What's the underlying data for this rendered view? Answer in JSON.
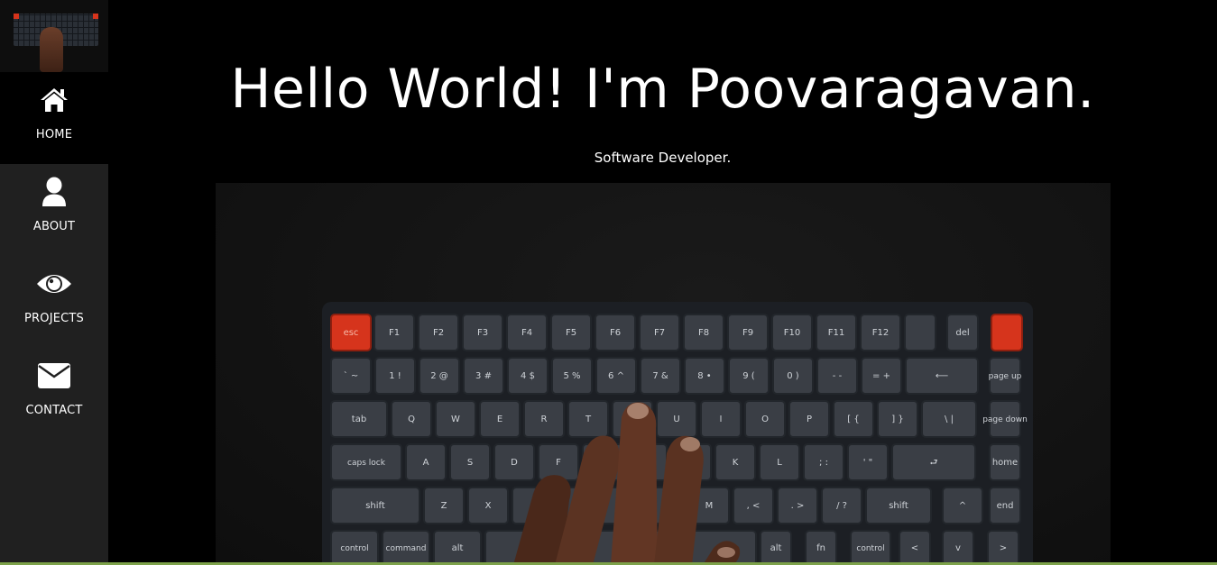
{
  "sidebar": {
    "items": [
      {
        "label": "HOME",
        "icon": "home-icon",
        "active": true
      },
      {
        "label": "ABOUT",
        "icon": "user-icon",
        "active": false
      },
      {
        "label": "PROJECTS",
        "icon": "eye-icon",
        "active": false
      },
      {
        "label": "CONTACT",
        "icon": "envelope-icon",
        "active": false
      }
    ]
  },
  "hero": {
    "title": "Hello World! I'm Poovaragavan.",
    "subtitle": "Software Developer."
  },
  "keyboard": {
    "rows": [
      [
        "esc",
        "F1",
        "F2",
        "F3",
        "F4",
        "F5",
        "F6",
        "F7",
        "F8",
        "F9",
        "F10",
        "F11",
        "F12",
        "",
        "del",
        ""
      ],
      [
        "` ~",
        "1 !",
        "2 @",
        "3 #",
        "4 $",
        "5 %",
        "6 ^",
        "7 &",
        "8 •",
        "9 (",
        "0 )",
        "- -",
        "= +",
        "⟵",
        "page up"
      ],
      [
        "tab",
        "Q",
        "W",
        "E",
        "R",
        "T",
        "",
        "U",
        "I",
        "O",
        "P",
        "[ {",
        "] }",
        "\\ |",
        "page down"
      ],
      [
        "caps lock",
        "A",
        "S",
        "D",
        "F",
        "",
        "",
        "",
        "K",
        "L",
        "; :",
        "' \"",
        "⮐",
        "home"
      ],
      [
        "shift",
        "Z",
        "X",
        "",
        "",
        "",
        "",
        "M",
        ", <",
        ". >",
        "/ ?",
        "shift",
        "^",
        "end"
      ],
      [
        "control",
        "command",
        "alt",
        "",
        "alt",
        "fn",
        "control",
        "<",
        "v",
        ">"
      ]
    ]
  },
  "colors": {
    "sidebar_bg": "#202020",
    "active_bg": "#000000",
    "page_bg": "#000000",
    "accent_key": "#d6341c",
    "bottom_strip": "#7da24a"
  }
}
